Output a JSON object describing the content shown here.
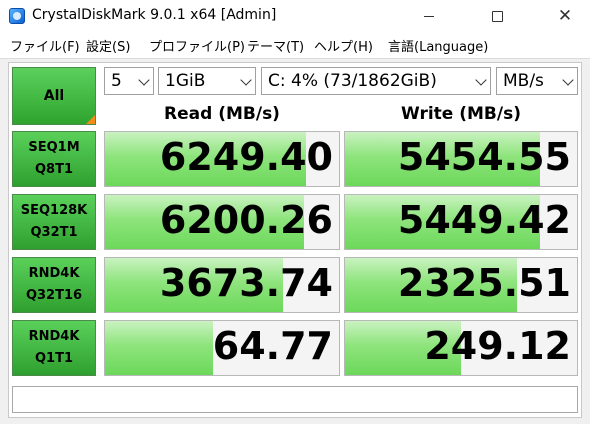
{
  "window": {
    "title": "CrystalDiskMark 9.0.1 x64 [Admin]"
  },
  "menu": [
    "ファイル(F)",
    "設定(S)",
    "プロファイル(P)",
    "テーマ(T)",
    "ヘルプ(H)",
    "言語(Language)"
  ],
  "controls": {
    "all_label": "All",
    "count": "5",
    "size": "1GiB",
    "drive": "C: 4% (73/1862GiB)",
    "unit": "MB/s"
  },
  "headers": {
    "read": "Read (MB/s)",
    "write": "Write (MB/s)"
  },
  "colors": {
    "bar": "#6cd85a",
    "button": "#2fa02f",
    "accent": "#f28c1c"
  },
  "tests": [
    {
      "line1": "SEQ1M",
      "line2": "Q8T1",
      "read": "6249.40",
      "write": "5454.55",
      "read_fill": 0.86,
      "write_fill": 0.84
    },
    {
      "line1": "SEQ128K",
      "line2": "Q32T1",
      "read": "6200.26",
      "write": "5449.42",
      "read_fill": 0.85,
      "write_fill": 0.84
    },
    {
      "line1": "RND4K",
      "line2": "Q32T16",
      "read": "3673.74",
      "write": "2325.51",
      "read_fill": 0.76,
      "write_fill": 0.74
    },
    {
      "line1": "RND4K",
      "line2": "Q1T1",
      "read": "64.77",
      "write": "249.12",
      "read_fill": 0.46,
      "write_fill": 0.5
    }
  ]
}
